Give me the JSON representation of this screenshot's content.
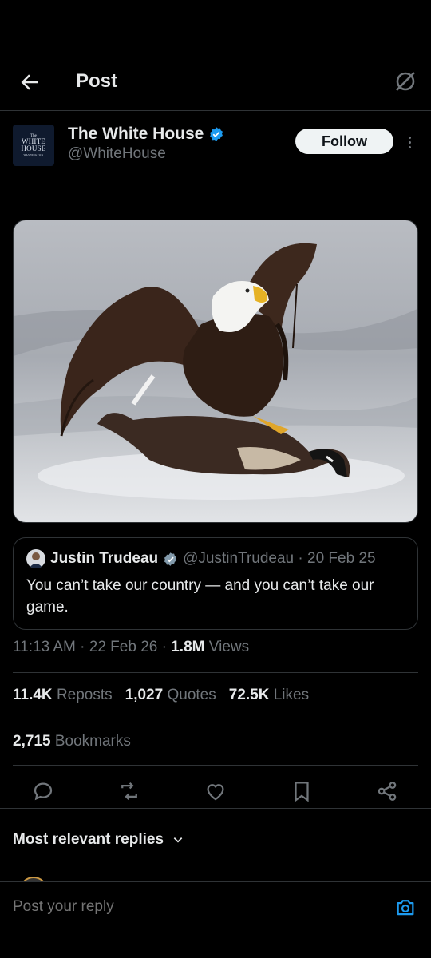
{
  "header": {
    "title": "Post",
    "back_icon": "arrow-left-icon",
    "grok_icon": "grok-icon"
  },
  "author": {
    "avatar_lines": [
      "The",
      "WHITE",
      "HOUSE",
      "WASHINGTON"
    ],
    "name": "The White House",
    "handle": "@WhiteHouse",
    "follow_label": "Follow"
  },
  "quote": {
    "name": "Justin Trudeau",
    "handle_date": "@JustinTrudeau · 20 Feb 25",
    "text": "You can’t take our country — and you can’t take our game."
  },
  "meta": {
    "time": "11:13 AM",
    "date": "22 Feb 26",
    "views_count": "1.8M",
    "views_label": "Views"
  },
  "stats": {
    "reposts_count": "11.4K",
    "reposts_label": "Reposts",
    "quotes_count": "1,027",
    "quotes_label": "Quotes",
    "likes_count": "72.5K",
    "likes_label": "Likes",
    "bookmarks_count": "2,715",
    "bookmarks_label": "Bookmarks"
  },
  "actions": [
    "reply-icon",
    "repost-icon",
    "like-icon",
    "bookmark-icon",
    "share-icon"
  ],
  "replies": {
    "sort_label": "Most relevant replies"
  },
  "reply_bar": {
    "placeholder": "Post your reply"
  },
  "colors": {
    "background": "#000000",
    "accent": "#1d9bf0",
    "text": "#e7e9ea",
    "muted": "#71767b",
    "verified": "#1d9bf0"
  }
}
